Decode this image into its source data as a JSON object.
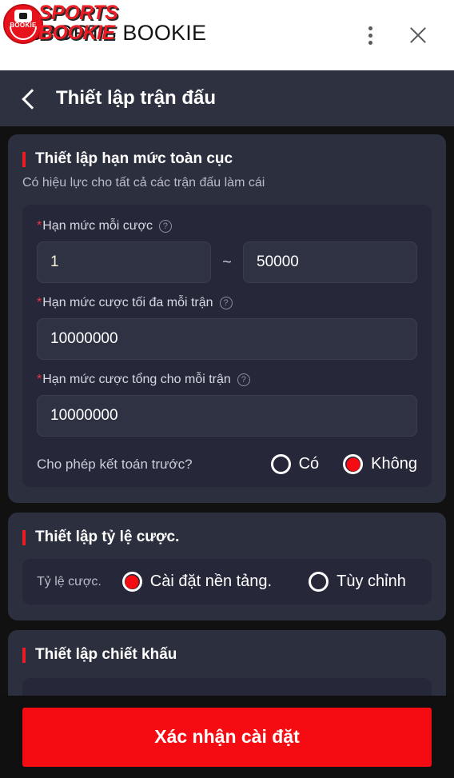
{
  "header": {
    "brand_text": "SPORTS BOOKIE",
    "logo_line1": "SPORTS",
    "logo_line2": "BOOKIE",
    "logo_badge_text": "BOOKIE",
    "menu_icon": "kebab-menu-icon",
    "close_icon": "close-icon"
  },
  "navbar": {
    "back_icon": "back-chevron-icon",
    "title": "Thiết lập trận đấu"
  },
  "sections": {
    "global_limit": {
      "title": "Thiết lập hạn mức toàn cục",
      "subtitle": "Có hiệu lực cho tất cả các trận đấu làm cái",
      "fields": {
        "per_bet": {
          "required_mark": "*",
          "label": "Hạn mức mỗi cược",
          "help_icon": "question-mark-icon",
          "min_value": "1",
          "max_value": "50000",
          "separator": "~"
        },
        "max_per_match": {
          "required_mark": "*",
          "label": "Hạn mức cược tối đa mỗi trận",
          "help_icon": "question-mark-icon",
          "value": "10000000"
        },
        "total_per_match": {
          "required_mark": "*",
          "label": "Hạn mức cược tổng cho mỗi trận",
          "help_icon": "question-mark-icon",
          "value": "10000000"
        }
      },
      "early_settlement": {
        "label": "Cho phép kết toán trước?",
        "options": [
          {
            "label": "Có",
            "selected": false
          },
          {
            "label": "Không",
            "selected": true
          }
        ]
      }
    },
    "odds": {
      "title": "Thiết lập tỷ lệ cược.",
      "row_label": "Tỷ lệ cược.",
      "options": [
        {
          "label": "Cài đặt nền tảng.",
          "selected": true
        },
        {
          "label": "Tùy chỉnh",
          "selected": false
        }
      ]
    },
    "discount": {
      "title": "Thiết lập chiết khấu"
    }
  },
  "footer": {
    "confirm_label": "Xác nhận cài đặt"
  },
  "colors": {
    "accent_red": "#f50b12",
    "logo_red": "#ed1c24",
    "card_bg": "#2c2f3e",
    "panel_bg": "#262839",
    "input_bg": "#2f3243",
    "navbar_bg": "#2e3140",
    "page_bg": "#111112",
    "footer_bg": "#0f0f10"
  }
}
